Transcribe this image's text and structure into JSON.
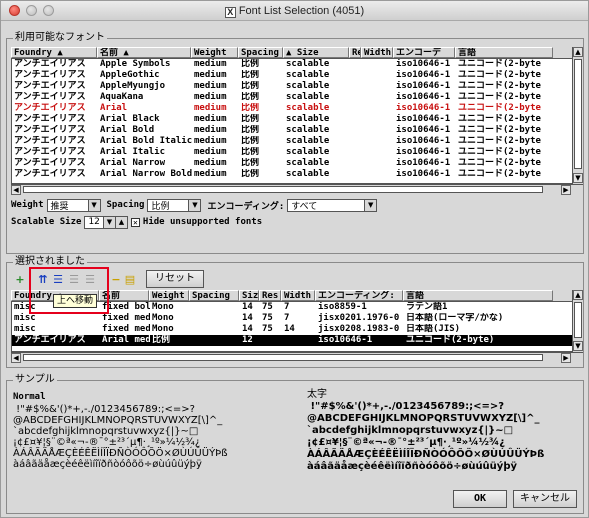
{
  "window": {
    "title": "Font List Selection (4051)"
  },
  "available": {
    "legend": "利用可能なフォント",
    "columns": [
      "Foundry ▲",
      "名前 ▲",
      "Weight",
      "Spacing",
      "▲ Size",
      "Re",
      "Width",
      "エンコーデ",
      "言語"
    ],
    "rows": [
      [
        "アンチエイリアス",
        "Apple Symbols",
        "medium",
        "比例",
        "scalable",
        "",
        "",
        "iso10646-1",
        "ユニコード(2-byte"
      ],
      [
        "アンチエイリアス",
        "AppleGothic",
        "medium",
        "比例",
        "scalable",
        "",
        "",
        "iso10646-1",
        "ユニコード(2-byte"
      ],
      [
        "アンチエイリアス",
        "AppleMyungjo",
        "medium",
        "比例",
        "scalable",
        "",
        "",
        "iso10646-1",
        "ユニコード(2-byte"
      ],
      [
        "アンチエイリアス",
        "AquaKana",
        "medium",
        "比例",
        "scalable",
        "",
        "",
        "iso10646-1",
        "ユニコード(2-byte"
      ],
      [
        "アンチエイリアス",
        "Arial",
        "medium",
        "比例",
        "scalable",
        "",
        "",
        "iso10646-1",
        "ユニコード(2-byte"
      ],
      [
        "アンチエイリアス",
        "Arial Black",
        "medium",
        "比例",
        "scalable",
        "",
        "",
        "iso10646-1",
        "ユニコード(2-byte"
      ],
      [
        "アンチエイリアス",
        "Arial Bold",
        "medium",
        "比例",
        "scalable",
        "",
        "",
        "iso10646-1",
        "ユニコード(2-byte"
      ],
      [
        "アンチエイリアス",
        "Arial Bold Italic",
        "medium",
        "比例",
        "scalable",
        "",
        "",
        "iso10646-1",
        "ユニコード(2-byte"
      ],
      [
        "アンチエイリアス",
        "Arial Italic",
        "medium",
        "比例",
        "scalable",
        "",
        "",
        "iso10646-1",
        "ユニコード(2-byte"
      ],
      [
        "アンチエイリアス",
        "Arial Narrow",
        "medium",
        "比例",
        "scalable",
        "",
        "",
        "iso10646-1",
        "ユニコード(2-byte"
      ],
      [
        "アンチエイリアス",
        "Arial Narrow Bold",
        "medium",
        "比例",
        "scalable",
        "",
        "",
        "iso10646-1",
        "ユニコード(2-byte"
      ]
    ],
    "red_row": 4
  },
  "filters": {
    "weight_label": "Weight",
    "weight_value": "推奨",
    "spacing_label": "Spacing",
    "spacing_value": "比例",
    "encoding_label": "エンコーディング:",
    "encoding_value": "すべて",
    "scalable_label": "Scalable Size",
    "scalable_value": "12",
    "hide_label": "Hide unsupported fonts",
    "hide_checked": "✕"
  },
  "selected": {
    "legend": "選択されました",
    "reset_label": "リセット",
    "tooltip": "上へ移動",
    "columns": [
      "Foundry ▲",
      "名前",
      "Weight",
      "Spacing",
      "Size",
      "Res",
      "Width",
      "エンコーディング:",
      "言語"
    ],
    "rows": [
      [
        "misc",
        "fixed bold",
        "Mono",
        "",
        "14",
        "75",
        "7",
        "iso8859-1",
        "ラテン語1"
      ],
      [
        "misc",
        "fixed medium*",
        "Mono",
        "",
        "14",
        "75",
        "7",
        "jisx0201.1976-0",
        "日本語(ローマ字/かな)"
      ],
      [
        "misc",
        "fixed medium*",
        "Mono",
        "",
        "14",
        "75",
        "14",
        "jisx0208.1983-0",
        "日本語(JIS)"
      ],
      [
        "アンチエイリアス",
        "Arial medium",
        "比例",
        "",
        "12",
        "",
        "",
        "iso10646-1",
        "ユニコード(2-byte)"
      ]
    ],
    "selected_row": 3
  },
  "sample": {
    "legend": "サンプル",
    "left_title": "Normal",
    "left_lines": [
      " !\"#$%&'()*+,-./0123456789:;<=>?",
      "@ABCDEFGHIJKLMNOPQRSTUVWXYZ[\\]^_",
      "`abcdefghijklmnopqrstuvwxyz{|}~□",
      "¡¢£¤¥¦§¨©ª«¬-®¯°±²³´µ¶·¸¹º»¼½¾¿",
      "ÀÁÂÃÄÅÆÇÈÉÊËÌÍÎÏÐÑÒÓÔÕÖ×ØÙÚÛÜÝÞß",
      "àáâãäåæçèéêëìíîïðñòóôõö÷øùúûüýþÿ"
    ],
    "right_title": "太字",
    "right_lines": [
      " !\"#$%&'()*+,-./0123456789:;<=>?",
      "@ABCDEFGHIJKLMNOPQRSTUVWXYZ[\\]^_",
      "`abcdefghijklmnopqrstuvwxyz{|}~□",
      "¡¢£¤¥¦§¨©ª«¬-®¯°±²³´µ¶·¸¹º»¼½¾¿",
      "ÀÁÂÃÄÅÆÇÈÉÊËÌÍÎÏÐÑÒÓÔÕÖ×ØÙÚÛÜÝÞß",
      "àáâãäåæçèéêëìíîïðñòóôõö÷øùúûüýþÿ"
    ]
  },
  "buttons": {
    "ok": "OK",
    "cancel": "キャンセル"
  },
  "colors": {
    "highlight": "#e5001c",
    "red_text": "#c81010"
  }
}
